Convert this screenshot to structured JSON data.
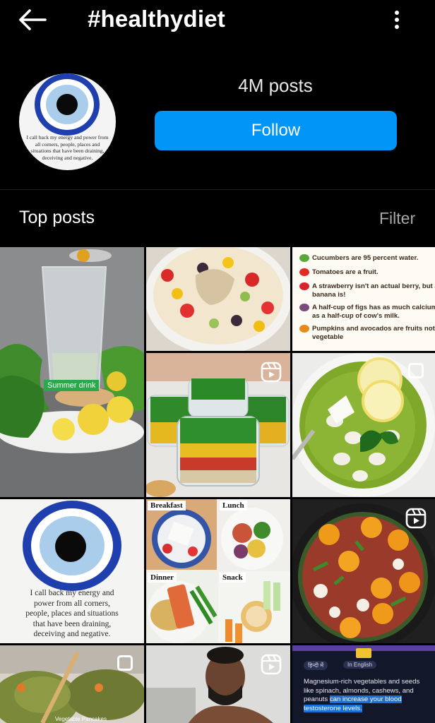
{
  "header": {
    "title": "#healthydiet",
    "back_icon": "arrow-left-icon",
    "more_icon": "more-vertical-icon"
  },
  "profile": {
    "avatar_caption": "I call back my energy and power from all corners, people, places and situations that have been draining, deceiving and negative.",
    "posts_count": "4M posts",
    "follow_label": "Follow"
  },
  "section": {
    "title": "Top posts",
    "filter_label": "Filter"
  },
  "posts": {
    "summer_label": "Summer drink",
    "facts": [
      "Cucumbers are 95 percent water.",
      "Tomatoes are a fruit.",
      "A strawberry isn't an actual berry, but a banana is!",
      "A half-cup of figs has as much calcium as a half-cup of cow's milk.",
      "Pumpkins and avocados are fruits not a vegetable"
    ],
    "evil_eye_caption": "I call back my energy and power from all corners, people, places and situations that have been draining, deceiving and negative.",
    "meal_labels": [
      "Breakfast",
      "Lunch",
      "Dinner",
      "Snack"
    ],
    "partial_caption": "Vegetable Pancakes",
    "magnesium": {
      "lang_hindi": "हिन्दी में",
      "lang_english": "In English",
      "text": "Magnesium-rich vegetables and seeds like spinach, almonds, cashews, and peanuts",
      "highlight": "can increase your blood testosterone levels."
    }
  },
  "colors": {
    "follow_blue": "#0095f6",
    "background": "#000000",
    "evil_eye_dark": "#1f3fae",
    "evil_eye_light": "#a9cdea"
  }
}
